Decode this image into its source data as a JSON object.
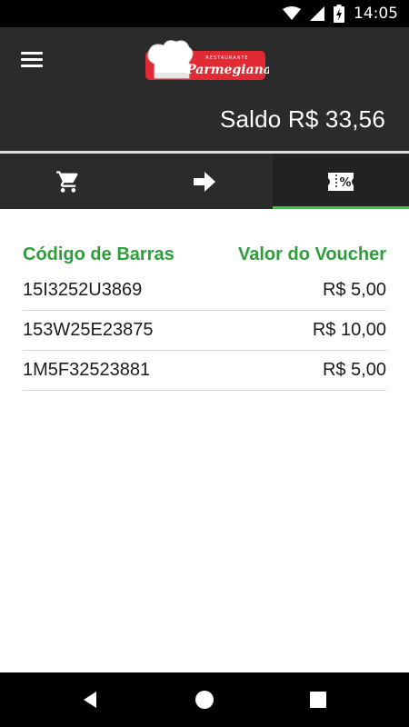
{
  "status_bar": {
    "time": "14:05",
    "icons": [
      "wifi-icon",
      "signal-icon",
      "battery-charging-icon"
    ]
  },
  "header": {
    "logo_top_text": "RESTAURANTE",
    "logo_brand_text": "Parmegiana",
    "balance": "Saldo R$ 33,56"
  },
  "tabs": [
    {
      "icon": "cart-icon",
      "active": false
    },
    {
      "icon": "arrow-right-icon",
      "active": false
    },
    {
      "icon": "voucher-percent-icon",
      "active": true
    }
  ],
  "table": {
    "headers": {
      "code": "Código de Barras",
      "value": "Valor do Voucher"
    },
    "rows": [
      {
        "code": "15I3252U3869",
        "value": "R$ 5,00"
      },
      {
        "code": "153W25E23875",
        "value": "R$ 10,00"
      },
      {
        "code": "1M5F32523881",
        "value": "R$ 5,00"
      }
    ]
  },
  "colors": {
    "app_bar": "#2b2b2b",
    "accent_green": "#2e9e3a",
    "tab_indicator": "#2ecc40",
    "logo_red": "#e02b35"
  },
  "nav_bar": {
    "icons": [
      "back-icon",
      "home-icon",
      "recents-icon"
    ]
  }
}
